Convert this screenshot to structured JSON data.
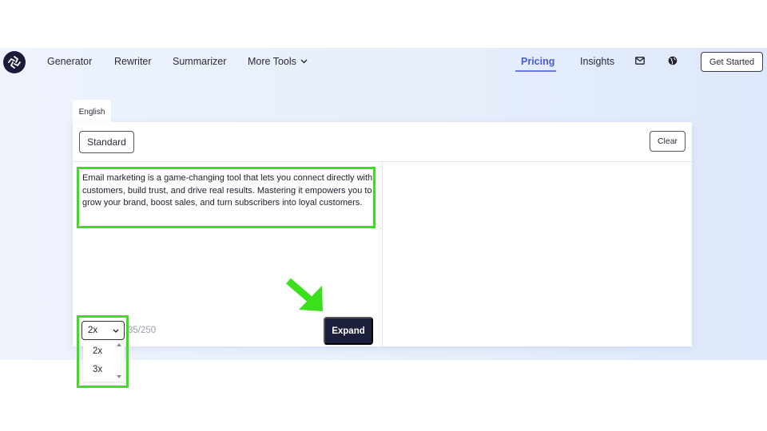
{
  "nav": {
    "items": [
      {
        "label": "Generator"
      },
      {
        "label": "Rewriter"
      },
      {
        "label": "Summarizer"
      },
      {
        "label": "More Tools"
      },
      {
        "label": "Pricing"
      },
      {
        "label": "Insights"
      }
    ],
    "cta": "Get Started",
    "icons": [
      "logo-icon",
      "mail-icon",
      "globe-icon",
      "chevron-down-icon"
    ]
  },
  "editor": {
    "language_tab": "English",
    "mode": "Standard",
    "clear": "Clear",
    "input_text": "Email marketing is a game-changing tool that lets you connect directly with customers, build trust, and drive real results. Mastering it empowers you to grow your brand, boost sales, and turn subscribers into loyal customers.",
    "multiplier": {
      "selected": "2x",
      "options": [
        "2x",
        "3x"
      ]
    },
    "char_count": "35/250",
    "expand_button": "Expand"
  },
  "colors": {
    "highlight": "#3be01c",
    "accent": "#4a5bd8",
    "primary_button": "#1c1f3b"
  }
}
